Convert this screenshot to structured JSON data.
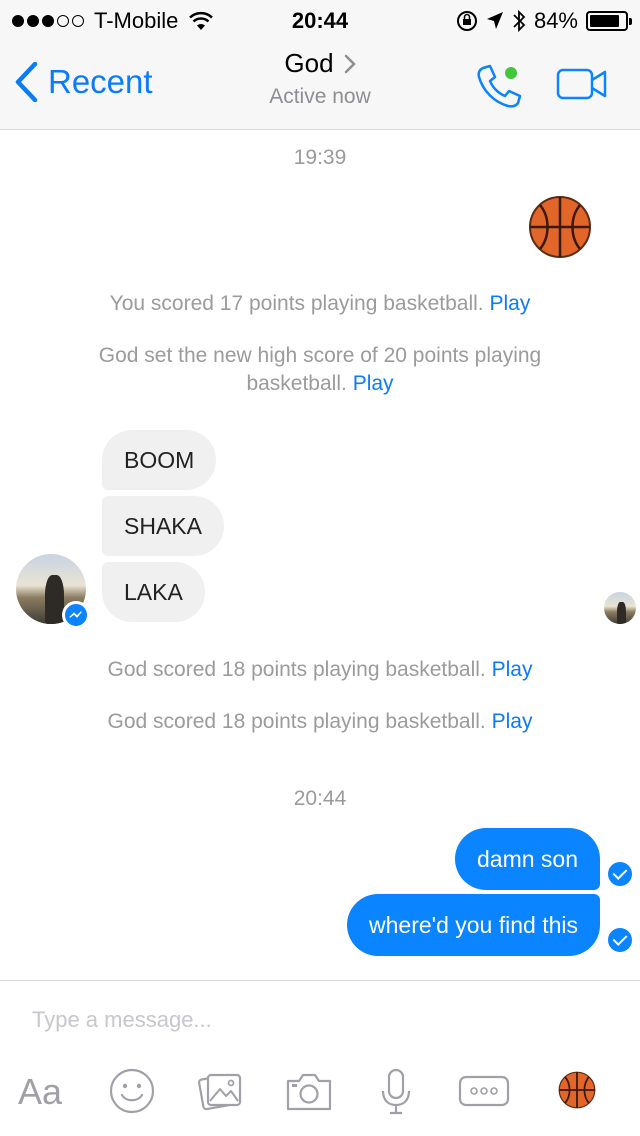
{
  "status_bar": {
    "carrier": "T-Mobile",
    "time": "20:44",
    "battery_percent": "84%",
    "battery_level": 0.84,
    "signal_bars": 3,
    "signal_total": 5
  },
  "nav": {
    "back_label": "Recent",
    "title": "God",
    "subtitle": "Active now"
  },
  "conversation": {
    "timestamp_1": "19:39",
    "sys_1_text": "You scored 17 points playing basketball.",
    "sys_1_link": "Play",
    "sys_2_text": "God set the new high score of 20 points playing basketball.",
    "sys_2_link": "Play",
    "incoming": [
      "BOOM",
      "SHAKA",
      "LAKA"
    ],
    "sys_3_text": "God scored 18 points playing basketball.",
    "sys_3_link": "Play",
    "sys_4_text": "God scored 18 points playing basketball.",
    "sys_4_link": "Play",
    "timestamp_2": "20:44",
    "outgoing": [
      "damn son",
      "where'd you find this"
    ]
  },
  "composer": {
    "placeholder": "Type a message...",
    "aa_label": "Aa"
  },
  "colors": {
    "accent": "#0a84ff",
    "link": "#0a7cf6",
    "online": "#42c63a"
  }
}
